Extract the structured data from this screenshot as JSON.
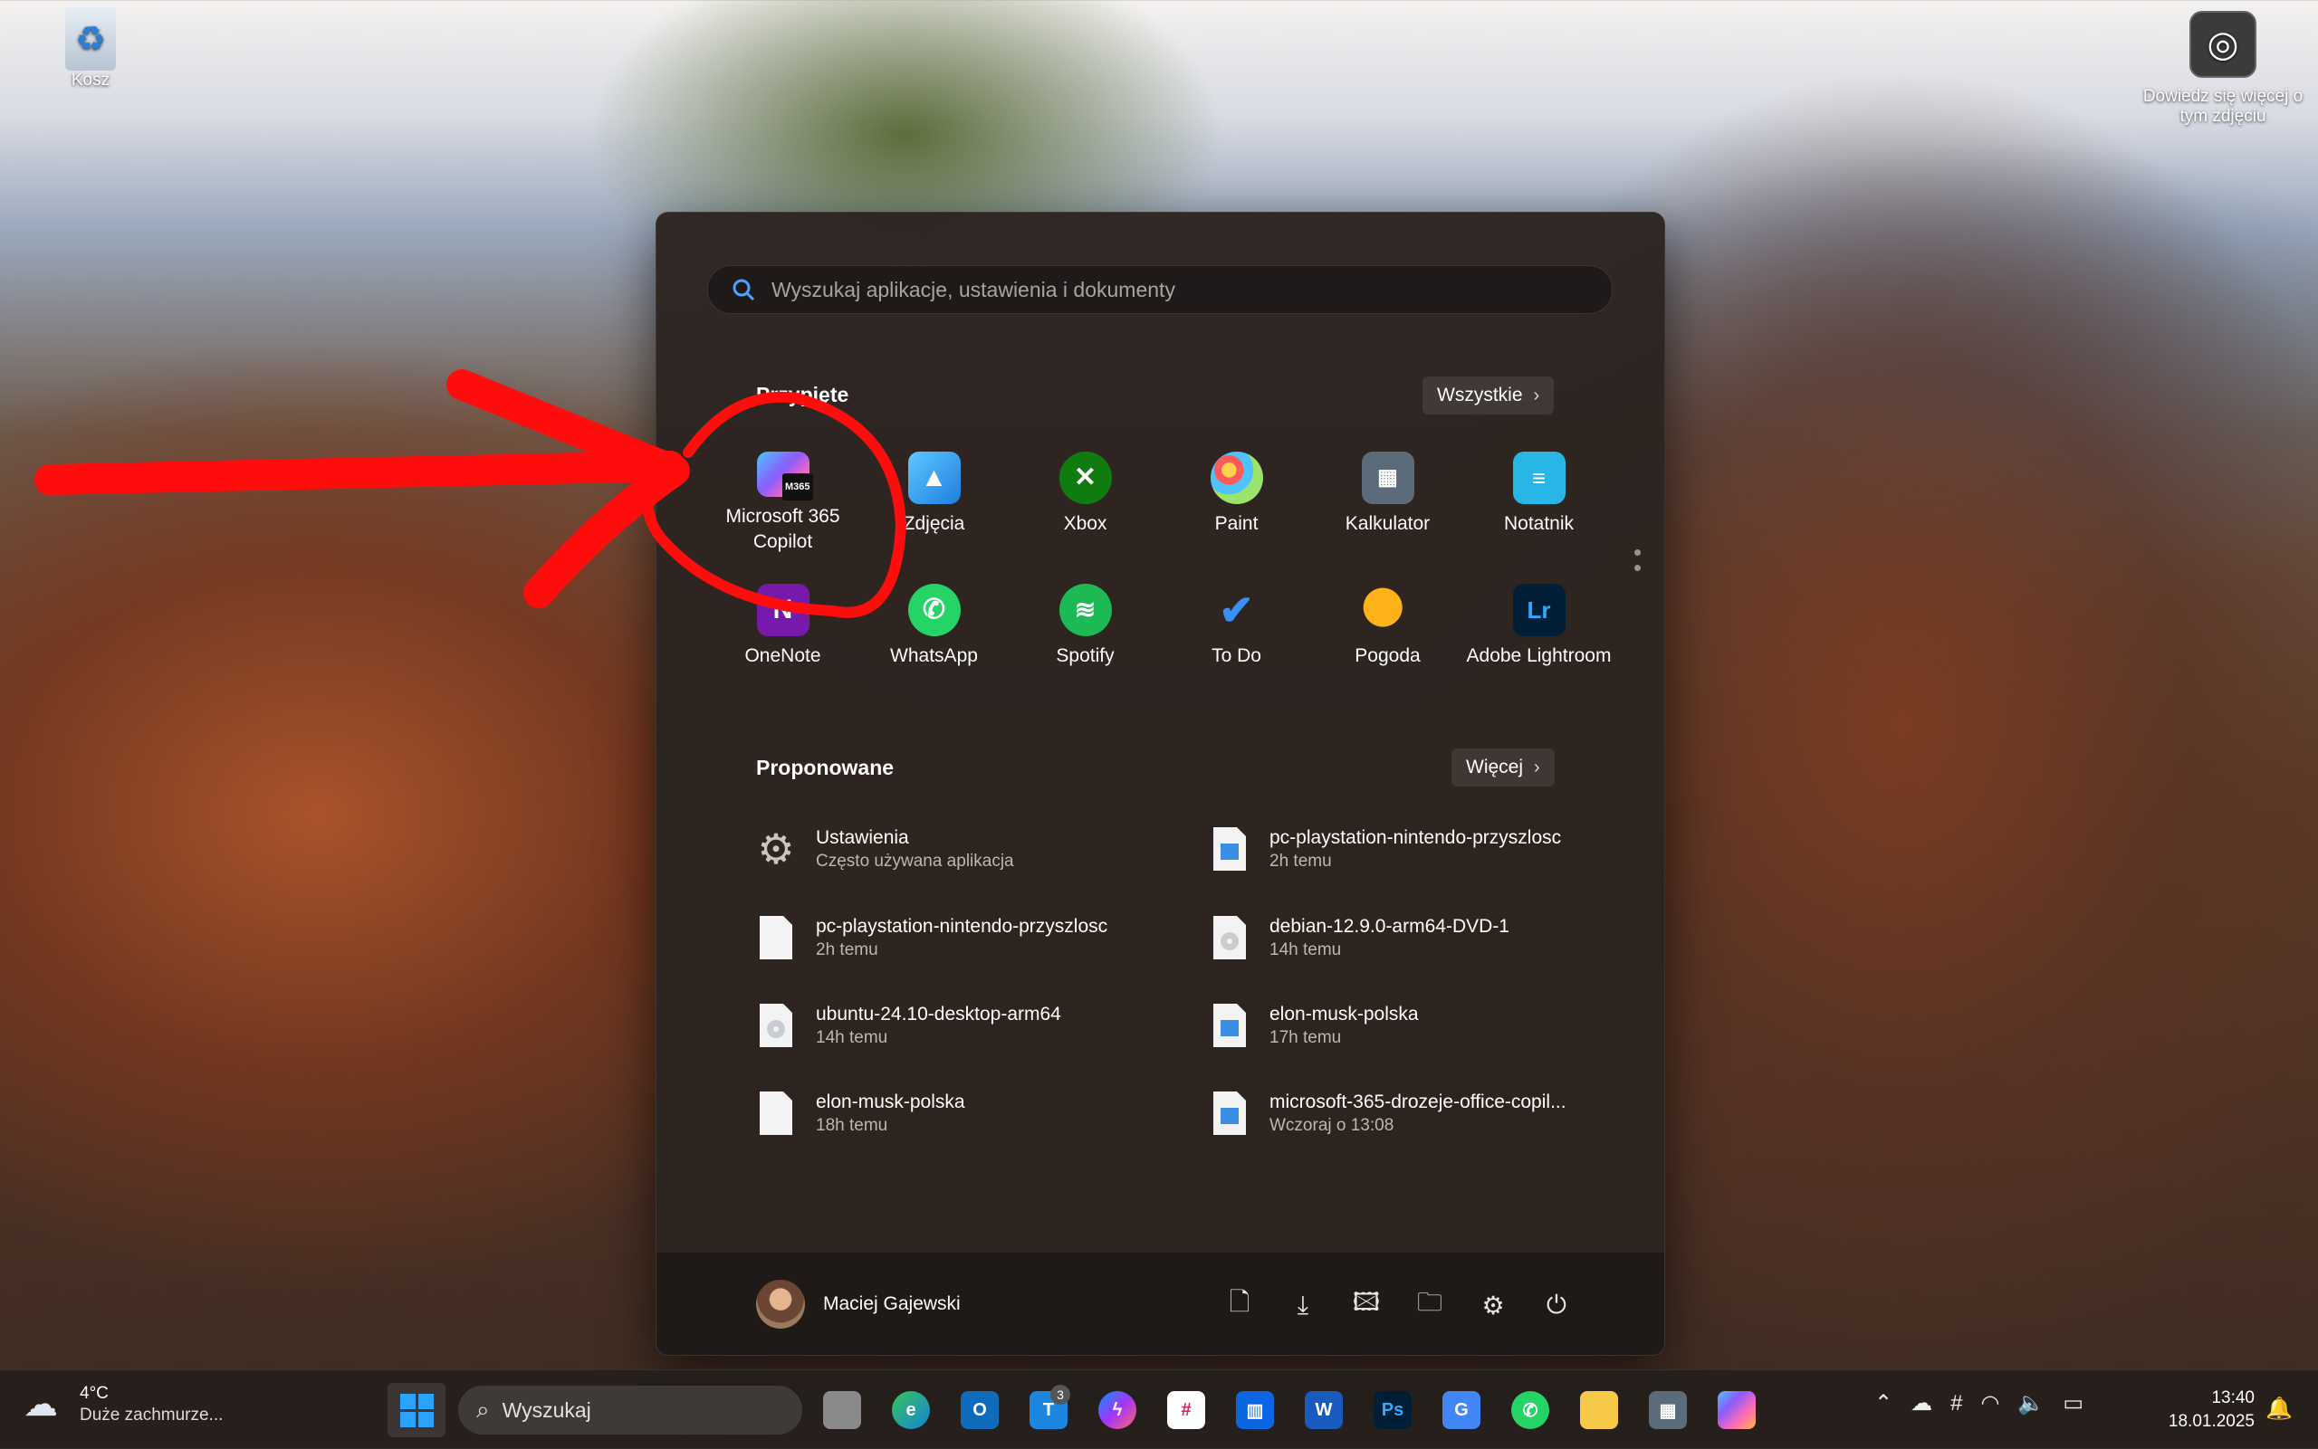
{
  "desktop": {
    "recycle_bin_label": "Kosz",
    "learn_more_label": "Dowiedz się więcej o tym zdjęciu"
  },
  "start_menu": {
    "search_placeholder": "Wyszukaj aplikacje, ustawienia i dokumenty",
    "pinned_title": "Przypięte",
    "all_button": "Wszystkie",
    "pinned_apps": [
      {
        "label": "Microsoft 365 Copilot",
        "icon": "m365-copilot-icon"
      },
      {
        "label": "Zdjęcia",
        "icon": "photos-icon"
      },
      {
        "label": "Xbox",
        "icon": "xbox-icon"
      },
      {
        "label": "Paint",
        "icon": "paint-icon"
      },
      {
        "label": "Kalkulator",
        "icon": "calculator-icon"
      },
      {
        "label": "Notatnik",
        "icon": "notepad-icon"
      },
      {
        "label": "OneNote",
        "icon": "onenote-icon"
      },
      {
        "label": "WhatsApp",
        "icon": "whatsapp-icon"
      },
      {
        "label": "Spotify",
        "icon": "spotify-icon"
      },
      {
        "label": "To Do",
        "icon": "todo-icon"
      },
      {
        "label": "Pogoda",
        "icon": "weather-icon"
      },
      {
        "label": "Adobe Lightroom",
        "icon": "lightroom-icon"
      }
    ],
    "recommended_title": "Proponowane",
    "more_button": "Więcej",
    "recommended": [
      {
        "name": "Ustawienia",
        "meta": "Często używana aplikacja",
        "icon": "settings-gear-icon"
      },
      {
        "name": "pc-playstation-nintendo-przyszlosc",
        "meta": "2h temu",
        "icon": "image-file-icon"
      },
      {
        "name": "pc-playstation-nintendo-przyszlosc",
        "meta": "2h temu",
        "icon": "blank-file-icon"
      },
      {
        "name": "debian-12.9.0-arm64-DVD-1",
        "meta": "14h temu",
        "icon": "disc-image-icon"
      },
      {
        "name": "ubuntu-24.10-desktop-arm64",
        "meta": "14h temu",
        "icon": "disc-image-icon"
      },
      {
        "name": "elon-musk-polska",
        "meta": "17h temu",
        "icon": "image-file-icon"
      },
      {
        "name": "elon-musk-polska",
        "meta": "18h temu",
        "icon": "blank-file-icon"
      },
      {
        "name": "microsoft-365-drozeje-office-copil...",
        "meta": "Wczoraj o 13:08",
        "icon": "image-file-icon"
      }
    ],
    "user_name": "Maciej Gajewski",
    "footer_icons": [
      "documents-icon",
      "downloads-icon",
      "pictures-icon",
      "file-explorer-icon",
      "settings-icon",
      "power-icon"
    ]
  },
  "taskbar": {
    "temperature": "4°C",
    "weather_condition": "Duże zachmurze...",
    "search_label": "Wyszukaj",
    "teams_badge": "3",
    "time": "13:40",
    "date": "18.01.2025"
  },
  "colors": {
    "annotation_red": "#ff0d0d",
    "accent_blue": "#2aa2ff"
  }
}
